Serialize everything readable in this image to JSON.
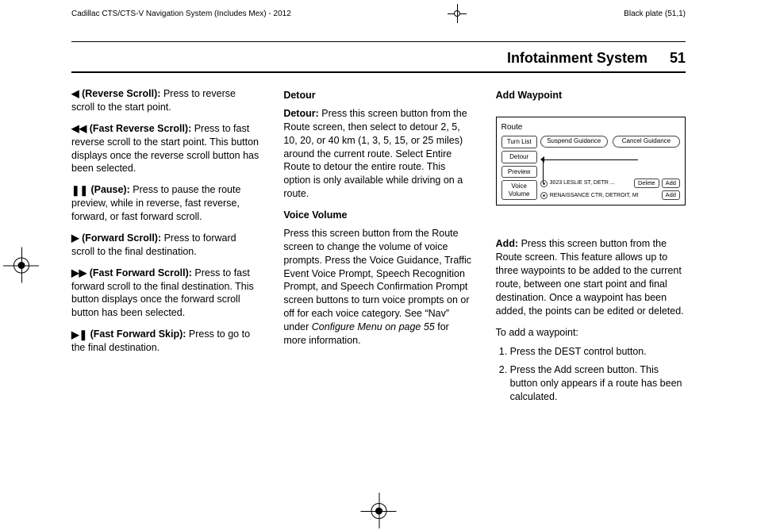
{
  "header": {
    "doc_title": "Cadillac CTS/CTS-V Navigation System (Includes Mex) - 2012",
    "plate": "Black plate (51,1)"
  },
  "page": {
    "section": "Infotainment System",
    "number": "51"
  },
  "col1": {
    "e1_label": "(Reverse Scroll):",
    "e1_text": "  Press to reverse scroll to the start point.",
    "e2_label": "(Fast Reverse Scroll):",
    "e2_text": "  Press to fast reverse scroll to the start point. This button displays once the reverse scroll button has been selected.",
    "e3_label": "(Pause):",
    "e3_text": "  Press to pause the route preview, while in reverse, fast reverse, forward, or fast forward scroll.",
    "e4_label": "(Forward Scroll):",
    "e4_text": "  Press to forward scroll to the final destination.",
    "e5_label": "(Fast Forward Scroll):",
    "e5_text": "  Press to fast forward scroll to the final destination. This button displays once the forward scroll button has been selected.",
    "e6_label": "(Fast Forward Skip):",
    "e6_text": "  Press to go to the final destination."
  },
  "col2": {
    "h1": "Detour",
    "p1_label": "Detour:",
    "p1_text": "  Press this screen button from the Route screen, then select to detour 2, 5, 10, 20, or 40 km (1, 3, 5, 15, or 25 miles) around the current route. Select Entire Route to detour the entire route. This option is only available while driving on a route.",
    "h2": "Voice Volume",
    "p2a": "Press this screen button from the Route screen to change the volume of voice prompts. Press the Voice Guidance, Traffic Event Voice Prompt, Speech Recognition Prompt, and Speech Confirmation Prompt screen buttons to turn voice prompts on or off for each voice category. See “Nav” under ",
    "p2b": "Configure Menu on page 55",
    "p2c": " for more information."
  },
  "col3": {
    "h1": "Add Waypoint",
    "fig": {
      "title": "Route",
      "side1": "Turn List",
      "side2": "Detour",
      "side3": "Preview",
      "side4": "Voice Volume",
      "top1": "Suspend Guidance",
      "top2": "Cancel Guidance",
      "row1_text": "3023 LESLIE ST, DETR ...",
      "row1_del": "Delete",
      "row1_add": "Add",
      "row2_text": "RENAISSANCE CTR, DETROIT, MI",
      "row2_add": "Add"
    },
    "p1_label": "Add:",
    "p1_text": "  Press this screen button from the Route screen. This feature allows up to three waypoints to be added to the current route, between one start point and final destination. Once a waypoint has been added, the points can be edited or deleted.",
    "p2": "To add a waypoint:",
    "li1": "Press the DEST control button.",
    "li2": "Press the Add screen button. This button only appears if a route has been calculated."
  }
}
